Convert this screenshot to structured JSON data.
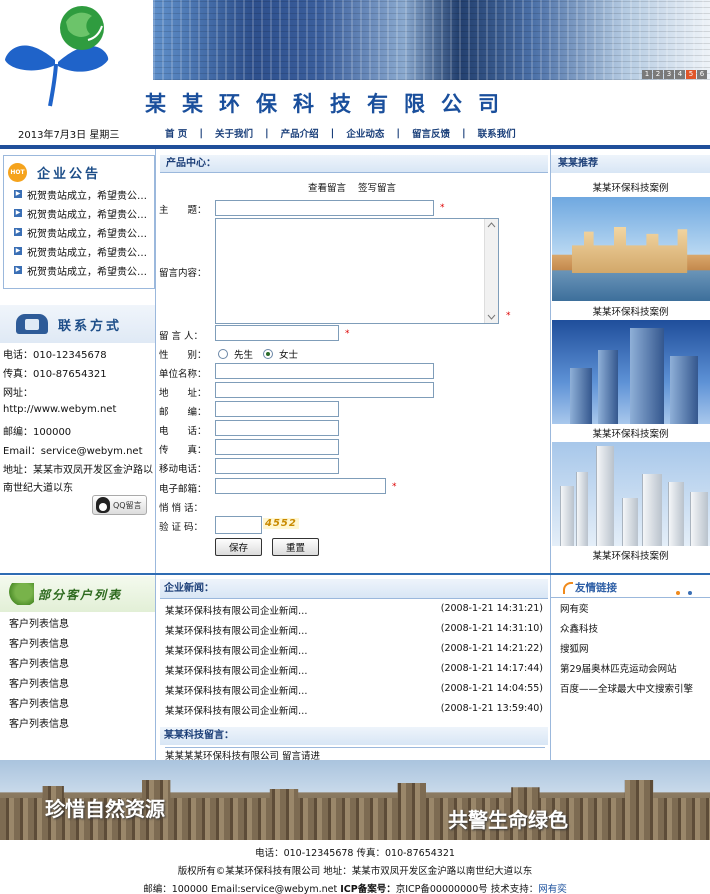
{
  "header": {
    "company_title": "某某环保科技有限公司",
    "date": "2013年7月3日 星期三",
    "pager": [
      "1",
      "2",
      "3",
      "4",
      "5",
      "6"
    ],
    "pager_active_index": 4
  },
  "nav": {
    "items": [
      "首 页",
      "关于我们",
      "产品介绍",
      "企业动态",
      "留言反馈",
      "联系我们"
    ]
  },
  "notice": {
    "badge": "HOT",
    "title": "企业公告",
    "items": [
      "祝贺贵站成立，希望贵公…",
      "祝贺贵站成立，希望贵公…",
      "祝贺贵站成立，希望贵公…",
      "祝贺贵站成立，希望贵公…",
      "祝贺贵站成立，希望贵公…"
    ]
  },
  "contact": {
    "title": "联系方式",
    "phone": "电话：010-12345678",
    "fax": "传真：010-87654321",
    "website_label": "网址：",
    "website": "http://www.webym.net",
    "postcode": "邮编：100000",
    "email": "Email：service@webym.net",
    "address1": "地址：某某市双凤开发区金沪路以",
    "address2": "南世纪大道以东",
    "qq_button": "QQ留言"
  },
  "clients": {
    "title": "部分客户列表",
    "items": [
      "客户列表信息",
      "客户列表信息",
      "客户列表信息",
      "客户列表信息",
      "客户列表信息",
      "客户列表信息"
    ]
  },
  "product_center": {
    "heading": "产品中心：",
    "view_link": "查看留言",
    "write_link": "签写留言"
  },
  "form": {
    "subject_label": "主　　题：",
    "content_label": "留言内容：",
    "name_label": "留 言 人：",
    "gender_label": "性　　别：",
    "gender_male": "先生",
    "gender_female": "女士",
    "gender_selected": "女士",
    "company_label": "单位名称：",
    "address_label": "地　　址：",
    "postcode_label": "邮　　编：",
    "phone_label": "电　　话：",
    "fax_label": "传　　真：",
    "mobile_label": "移动电话：",
    "email_label": "电子邮箱：",
    "whisper_label": "悄 悄 话：",
    "captcha_label": "验 证 码：",
    "captcha_value": "4552",
    "required_mark": "*",
    "save_button": "保存",
    "reset_button": "重置"
  },
  "news": {
    "heading": "企业新闻：",
    "rows": [
      {
        "title": "某某环保科技有限公司企业新闻…",
        "time": "(2008-1-21 14:31:21)"
      },
      {
        "title": "某某环保科技有限公司企业新闻…",
        "time": "(2008-1-21 14:31:10)"
      },
      {
        "title": "某某环保科技有限公司企业新闻…",
        "time": "(2008-1-21 14:21:22)"
      },
      {
        "title": "某某环保科技有限公司企业新闻…",
        "time": "(2008-1-21 14:17:44)"
      },
      {
        "title": "某某环保科技有限公司企业新闻…",
        "time": "(2008-1-21 14:04:55)"
      },
      {
        "title": "某某环保科技有限公司企业新闻…",
        "time": "(2008-1-21 13:59:40)"
      }
    ]
  },
  "guestbook": {
    "heading": "某某科技留言：",
    "line": "某某某某环保科技有限公司 留言请进"
  },
  "recommend": {
    "heading": "某某推荐",
    "captions": [
      "某某环保科技案例",
      "某某环保科技案例",
      "某某环保科技案例",
      "某某环保科技案例"
    ]
  },
  "friend_links": {
    "title": "友情链接",
    "items": [
      "网有奕",
      "众鑫科技",
      "搜狐网",
      "第29届奥林匹克运动会网站",
      "百度——全球最大中文搜索引擎"
    ]
  },
  "footer": {
    "slogan_left": "珍惜自然资源",
    "slogan_right": "共警生命绿色",
    "contact_line": "电话：010-12345678 传真：010-87654321",
    "copyright_line": "版权所有©某某环保科技有限公司  地址：某某市双凤开发区金沪路以南世纪大道以东",
    "postcode": "邮编：100000",
    "email": "Email:service@webym.net",
    "icp_label": "ICP备案号：",
    "icp_value": "京ICP备00000000号",
    "support_label": "技术支持：",
    "support_link": "网有奕"
  },
  "colors": {
    "brand_blue": "#1a4f9c",
    "nav_line": "#1f4f9a",
    "required": "#dd0000",
    "hot_orange": "#f5a31d"
  }
}
